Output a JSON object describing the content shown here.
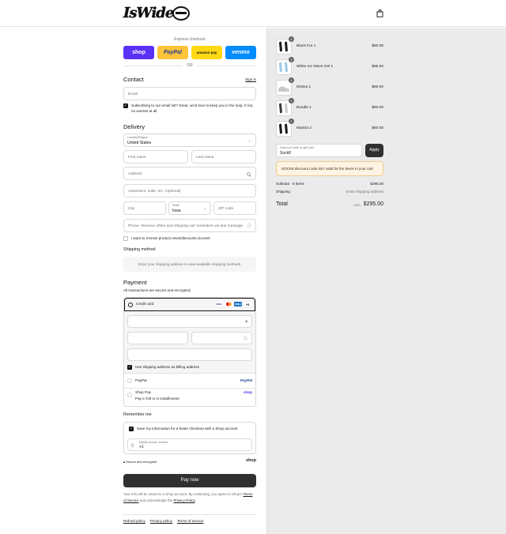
{
  "header": {
    "logo_text": "IsWide",
    "bag_icon": "shopping-bag-icon"
  },
  "express": {
    "label": "Express checkout",
    "buttons": [
      {
        "label": "shop",
        "color": "#5a31f4"
      },
      {
        "label": "PayPal",
        "color": "#ffc439"
      },
      {
        "label": "amazon pay",
        "color": "#ffd814"
      },
      {
        "label": "venmo",
        "color": "#008cff"
      }
    ],
    "or": "OR"
  },
  "contact": {
    "title": "Contact",
    "sign_in": "Sign in",
    "email_placeholder": "Email",
    "subscribe_text": "Subscribing to our email list? Great, we'd love to keep you in the loop. If not, no worries at all."
  },
  "delivery": {
    "title": "Delivery",
    "country_label": "Country/Region",
    "country_value": "United States",
    "first_name": "First name",
    "last_name": "Last name",
    "address": "Address",
    "apartment": "Apartment, suite, etc. (optional)",
    "city": "City",
    "state_label": "State",
    "state_value": "Iowa",
    "zip": "ZIP code",
    "phone": "Phone- Receive offers and shipping cart reminders via text message",
    "news_text": "I want to receive product news/discounts via text!"
  },
  "shipping": {
    "title": "Shipping method",
    "placeholder": "Enter your shipping address to view available shipping methods."
  },
  "payment": {
    "title": "Payment",
    "subtitle": "All transactions are secure and encrypted.",
    "credit_card": "Credit card",
    "card_brands": [
      "VISA",
      "MC",
      "AMEX"
    ],
    "more_cards": "+5",
    "billing_same": "Use shipping address as billing address",
    "paypal": "PayPal",
    "paypal_logo": "PayPal",
    "shop_pay": "Shop Pay",
    "shop_pay_sub": "Pay in full or in installments",
    "shop_logo": "shop"
  },
  "remember": {
    "title": "Remember me",
    "save_text": "Save my information for a faster checkout with a Shop account",
    "mobile_label": "Mobile phone number",
    "mobile_value": "+1",
    "secure": "Secure and encrypted",
    "shop_logo": "shop"
  },
  "pay_now": "Pay now",
  "legal": {
    "line1": "Your info will be saved to a Shop account. By continuing, you agree to Shop's",
    "terms": "Terms of Service",
    "middle": "and acknowledge the",
    "privacy": "Privacy Policy",
    "end": "."
  },
  "footer": [
    "Refund policy",
    "Privacy policy",
    "Terms of service"
  ],
  "cart": {
    "items": [
      {
        "name": "Black Fur 1",
        "price": "$60.00",
        "qty": "1",
        "color": "#1d1d1d"
      },
      {
        "name": "White Ice Wave Gel 1",
        "price": "$65.00",
        "qty": "1",
        "color": "#9ec8e8"
      },
      {
        "name": "Motiva 1",
        "price": "$60.00",
        "qty": "1",
        "color": "#c9c9c9"
      },
      {
        "name": "Bundle 1",
        "price": "$60.00",
        "qty": "1",
        "color": "#3a3a3a"
      },
      {
        "name": "Mantra 2",
        "price": "$50.00",
        "qty": "1",
        "color": "#1a1a1a"
      }
    ],
    "discount_label": "Discount code or gift card",
    "discount_value": "Sock8",
    "apply": "Apply",
    "alert": "SOCK8 discount code isn't valid for the items in your cart",
    "subtotal_label": "Subtotal · 5 items",
    "subtotal_value": "$295.00",
    "shipping_label": "Shipping",
    "shipping_value": "Enter shipping address",
    "total_label": "Total",
    "total_currency": "USD",
    "total_value": "$295.00"
  }
}
